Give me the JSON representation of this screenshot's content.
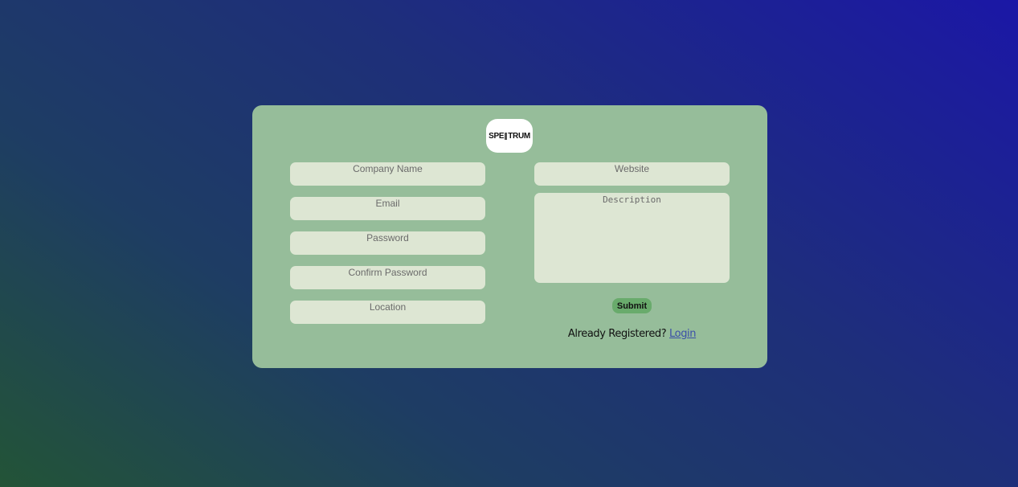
{
  "logo": {
    "left": "SPE",
    "right": "TRUM"
  },
  "form": {
    "company_name_placeholder": "Company Name",
    "email_placeholder": "Email",
    "password_placeholder": "Password",
    "confirm_password_placeholder": "Confirm Password",
    "location_placeholder": "Location",
    "website_placeholder": "Website",
    "description_placeholder": "Description",
    "submit_label": "Submit"
  },
  "footer": {
    "already_registered": "Already Registered?",
    "login_label": "Login"
  },
  "colors": {
    "card_background": "#96bd9a",
    "field_background": "#dde6d3",
    "submit_background": "#69ab6c"
  }
}
